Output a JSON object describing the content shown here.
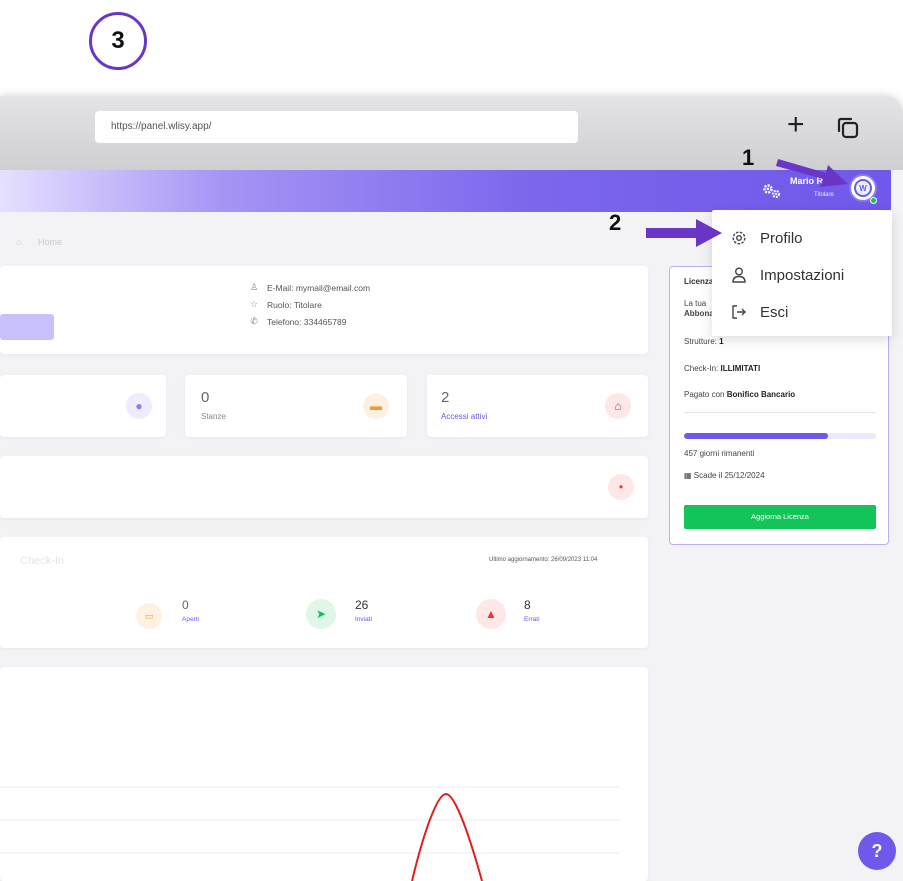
{
  "step": "3",
  "browser": {
    "url": "https://panel.wlisy.app/",
    "new_tab_symbol": "+"
  },
  "header": {
    "user_name": "Mario Rossi",
    "user_role": "Titolare",
    "avatar_initial": "W"
  },
  "breadcrumb": {
    "label": "Home"
  },
  "dropdown": {
    "items": [
      {
        "label": "Profilo",
        "icon": "gear-icon"
      },
      {
        "label": "Impostazioni",
        "icon": "user-icon"
      },
      {
        "label": "Esci",
        "icon": "logout-icon"
      }
    ]
  },
  "annotations": {
    "first": "1",
    "second": "2"
  },
  "profile": {
    "email_label": "E-Mail:",
    "email": "mymail@email.com",
    "role_label": "Ruolo:",
    "role": "Titolare",
    "phone_label": "Telefono:",
    "phone": "334465789"
  },
  "stats": {
    "rooms_value": "0",
    "rooms_label": "Stanze",
    "access_value": "2",
    "access_label": "Accessi attivi"
  },
  "checkin": {
    "title": "Check-In",
    "last_update": "Ultimo aggiornamento: 26/09/2023 11:04",
    "open_value": "0",
    "open_label": "Aperti",
    "sent_value": "26",
    "sent_label": "Inviati",
    "errors_value": "8",
    "errors_label": "Errati"
  },
  "license": {
    "title": "Licenza",
    "line1": "La tua",
    "line2": "Abbonamento",
    "structures_label": "Strutture:",
    "structures_value": "1",
    "checkin_label": "Check-In:",
    "checkin_value": "ILLIMITATI",
    "paid_label": "Pagato con",
    "paid_value": "Bonifico Bancario",
    "progress_fraction": 0.75,
    "days_left": "457 giorni rimanenti",
    "expiry": "Scade il 25/12/2024",
    "renew_label": "Aggiorna Licenza"
  },
  "help": {
    "label": "?"
  },
  "colors": {
    "accent": "#7058ea",
    "success": "#12c45a",
    "danger": "#e53935",
    "annotation": "#6a36c8"
  }
}
